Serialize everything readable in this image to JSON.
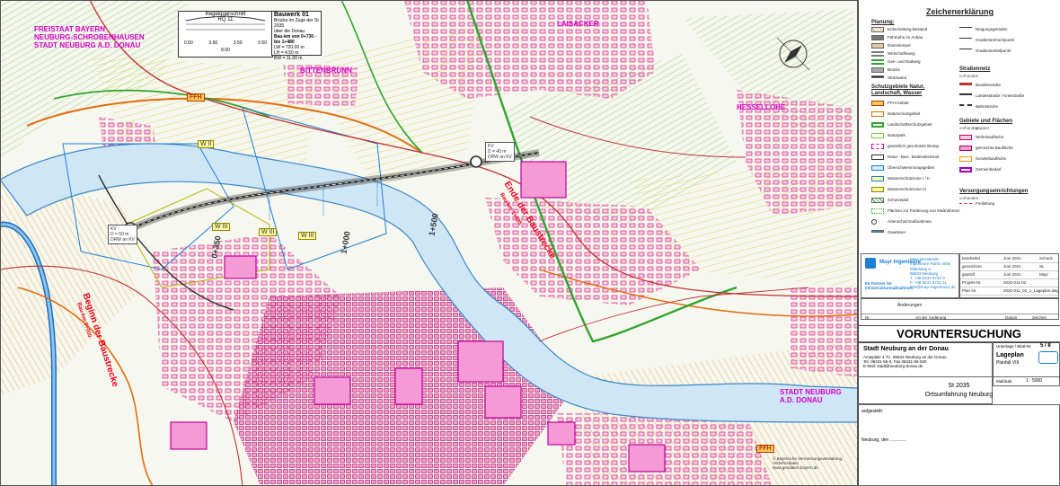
{
  "map": {
    "region_labels": [
      "FREISTAAT BAYERN",
      "NEUBURG-SCHROBENHAUSEN",
      "STADT NEUBURG A.D. DONAU"
    ],
    "place_laisacker": "LAISACKER",
    "place_bittenbrunn": "BITTENBRUNN",
    "place_hessellohe": "HESSELLOHE",
    "place_stadt_neuburg": [
      "STADT NEUBURG",
      "A.D. DONAU"
    ],
    "ffh_1": "FFH",
    "ffh_2": "FFH",
    "wz_1": "W II",
    "wz_2": "W III",
    "wz_3": "W III",
    "wz_4": "W III",
    "km_0350": "0+350",
    "km_1000": "1+000",
    "km_1500": "1+500",
    "beginn": "Beginn der Baustrecke",
    "beginn_sub": "Bau-km 0+000",
    "ende": "Ende der Baustrecke",
    "ende_sub": "Bau-km 1+835",
    "kv1": [
      "KV",
      "D = 50 m",
      "DRW an KV"
    ],
    "kv2": [
      "KV",
      "D = 40 m",
      "DRW an KV"
    ],
    "footnote": [
      "© Bayerische Vermessungsverwaltung, Verkehrsdaten",
      "www.geodaten.bayern.de"
    ]
  },
  "regelquerschnitt": {
    "title": "Regelquerschnitt",
    "rq": "RQ 11",
    "dims": [
      "0.50",
      "3.50",
      "3.50",
      "0.50"
    ],
    "total": "8.00"
  },
  "bauwerk": {
    "title": "Bauwerk 01",
    "desc": [
      "Brücke im Zuge der St 2035",
      "über die Donau"
    ],
    "range": "Bau-km von 0+730 - bis 1+480",
    "lines": [
      "LW = 720.00 m",
      "LH = 4.50 m",
      "BW = 11.00 m"
    ]
  },
  "legend": {
    "title": "Zeichenerklärung",
    "planung": "Planung:",
    "planung_items": [
      "Erdschüttung Bestand",
      "Fahrbahn im Anbau",
      "Dammkörper",
      "Wirtschaftsweg",
      "Geh- und Radweg",
      "Brücke",
      "Stützwand"
    ],
    "schutz": "Schutzgebiete Natur, Landschaft, Wasser",
    "schutz_items": [
      "FFH-Gebiet",
      "Naturschutzgebiet",
      "Landschaftsschutzgebiet",
      "Naturpark",
      "gesetzlich geschützte Biotop",
      "Natur-, Bau-, Bodendenkmal",
      "Überschwemmungsgebiet",
      "Wasserschutzzone I / II",
      "Wasserschutzzone III",
      "Schutzwald",
      "Flächen zur Förderung von Maßnahmen",
      "Artenschutzmaßnahmen",
      "Gewässer"
    ],
    "netz": "Straßennetz",
    "netz_sub": "vorhanden",
    "netz_items": [
      "Bundesstraße",
      "Landesstraße / Kreisstraße",
      "Bahnstrecke"
    ],
    "gebiete": "Gebiete und Flächen",
    "gebiete_sub": [
      "vorhanden",
      "geplant"
    ],
    "gebiete_items": [
      "Wohnbaufläche",
      "gemischte Baufläche",
      "Sonderbaufläche",
      "Gemeinbedarf"
    ],
    "versorgung": "Versorgungseinrichtungen",
    "versorgung_sub": "vorhanden",
    "versorgung_items": [
      "Freileitung"
    ],
    "top_right_items": [
      "Neigungsgeraden",
      "Gradientenhochpunkt",
      "Gradiententiefpunkt"
    ]
  },
  "title_block": {
    "firm": "Mayr Ingenieure",
    "firm_full": "Mayr Beratende Ingenieure PartG mbB",
    "address": [
      "Mittelweg 9",
      "86633 Neuburg",
      "T. +49 8431 6733 0",
      "F. +49 8431 6733 11",
      "info@mayr-ingenieure.de"
    ],
    "partner": "Ihr Partner für Infrastrukturmaßnahmen",
    "rows": [
      [
        "bearbeitet",
        "Juni 2021",
        "Schuck"
      ],
      [
        "gezeichnet",
        "Juni 2021",
        "SL"
      ],
      [
        "geprüft",
        "Juni 2021",
        "Mayr"
      ],
      [
        "Projekt-Nr.",
        "2020-011-02",
        ""
      ],
      [
        "Plan-Nr.",
        "2020-011_02_1_Lageplan.dwg",
        ""
      ]
    ],
    "aenderung_header": [
      "Nr.",
      "Art der Änderung",
      "Datum",
      "Zeichen"
    ],
    "aenderung_label": "Änderungen",
    "heading": "VORUNTERSUCHUNG",
    "client": "Stadt Neuburg an der Donau",
    "client_addr": [
      "Amtsplatz 4 7C, 86633 Neuburg an der Donau",
      "Tel. 08431-55-0, Fax 08431-55-520",
      "E-Mail: stadt@neuburg-donau.de"
    ],
    "unterlage_label": "Unterlage / Blatt-Nr.",
    "unterlage": "5 / 8",
    "plan_title": "Lageplan",
    "plan_sub": "Planfall VIII",
    "massstab_label": "Maßstab",
    "massstab": "1 : 5000",
    "project": "St 2035",
    "project_sub": "Ortsumfahrung Neuburg",
    "aufgestellt": "aufgestellt:",
    "signature": "Neuburg, den ............."
  }
}
